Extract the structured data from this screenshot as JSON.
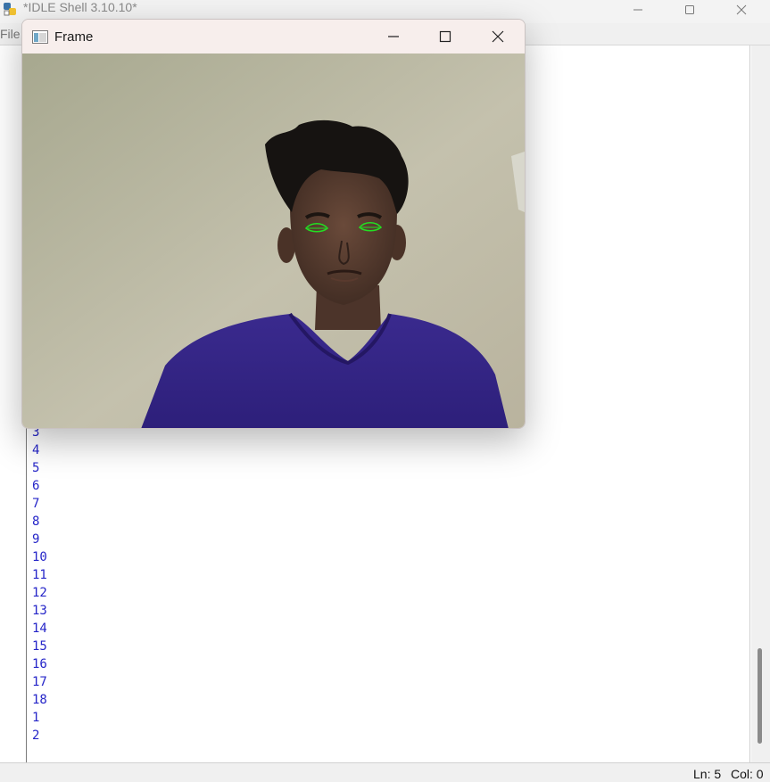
{
  "idle": {
    "title": "*IDLE Shell 3.10.10*",
    "menu": {
      "file": "File"
    },
    "output_lines": [
      "3",
      "4",
      "5",
      "6",
      "7",
      "8",
      "9",
      "10",
      "11",
      "12",
      "13",
      "14",
      "15",
      "16",
      "17",
      "18",
      "1",
      "2"
    ],
    "status": {
      "line": "Ln: 5",
      "col": "Col: 0"
    },
    "colors": {
      "output_text": "#2525c8"
    }
  },
  "frame": {
    "title": "Frame",
    "icons": [
      "window-app-icon",
      "minimize-icon",
      "maximize-icon",
      "close-icon"
    ],
    "colors": {
      "eye_contour": "#22e022"
    }
  }
}
